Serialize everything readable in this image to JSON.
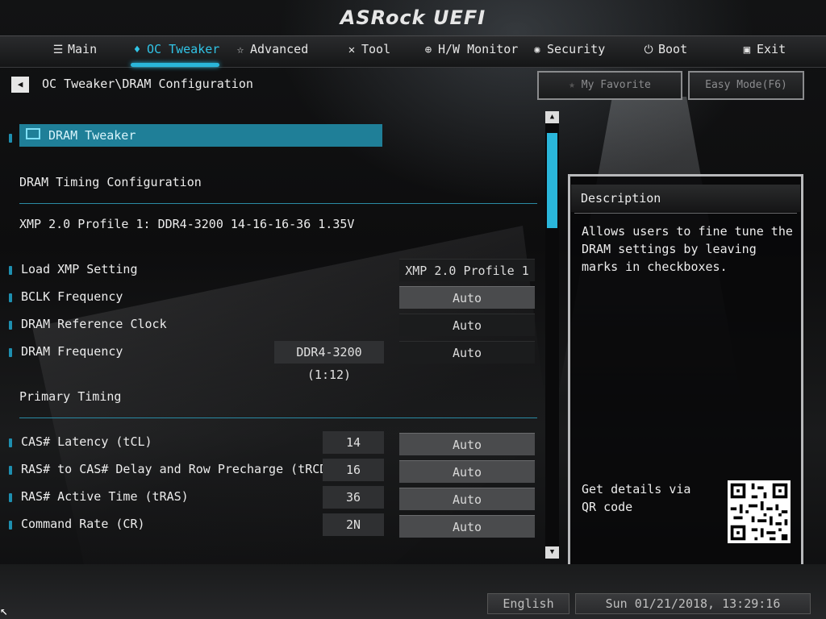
{
  "app": {
    "logo": "ASRock UEFI"
  },
  "nav": {
    "tabs": [
      {
        "label": "Main",
        "icon": "list-icon",
        "glyph": "☰"
      },
      {
        "label": "OC Tweaker",
        "icon": "rocket-icon",
        "glyph": "♦"
      },
      {
        "label": "Advanced",
        "icon": "star-icon",
        "glyph": "☆"
      },
      {
        "label": "Tool",
        "icon": "tools-icon",
        "glyph": "✕"
      },
      {
        "label": "H/W Monitor",
        "icon": "crosshair-icon",
        "glyph": "⊕"
      },
      {
        "label": "Security",
        "icon": "shield-icon",
        "glyph": "✺"
      },
      {
        "label": "Boot",
        "icon": "power-icon",
        "glyph": "⏻"
      },
      {
        "label": "Exit",
        "icon": "exit-icon",
        "glyph": "▣"
      }
    ],
    "active": "OC Tweaker"
  },
  "breadcrumb": "OC Tweaker\\DRAM Configuration",
  "top_buttons": {
    "favorite": "My Favorite",
    "easy_mode": "Easy Mode(F6)"
  },
  "section": {
    "title": "DRAM Tweaker"
  },
  "headings": {
    "timing_config": "DRAM Timing Configuration",
    "xmp_info": "XMP 2.0 Profile 1: DDR4-3200 14-16-16-36 1.35V",
    "primary_timing": "Primary Timing"
  },
  "settings": [
    {
      "label": "Load XMP Setting",
      "current": "",
      "value": "XMP 2.0 Profile 1"
    },
    {
      "label": "BCLK Frequency",
      "current": "",
      "value": "Auto"
    },
    {
      "label": "DRAM Reference Clock",
      "current": "",
      "value": "Auto"
    },
    {
      "label": "DRAM Frequency",
      "current": "DDR4-3200 (1:12)",
      "value": "Auto"
    },
    {
      "label": "CAS# Latency (tCL)",
      "current": "14",
      "value": "Auto"
    },
    {
      "label": "RAS# to CAS# Delay and Row Precharge (tRCDtRP)",
      "current": "16",
      "value": "Auto"
    },
    {
      "label": "RAS# Active Time (tRAS)",
      "current": "36",
      "value": "Auto"
    },
    {
      "label": "Command Rate (CR)",
      "current": "2N",
      "value": "Auto"
    }
  ],
  "description": {
    "title": "Description",
    "text": "Allows users to fine tune the DRAM settings by leaving marks in checkboxes.",
    "qr_text": "Get details via QR code"
  },
  "footer": {
    "language": "English",
    "datetime": "Sun 01/21/2018, 13:29:16"
  },
  "colors": {
    "accent": "#2ab6da",
    "section_bg": "#1f7f98"
  }
}
